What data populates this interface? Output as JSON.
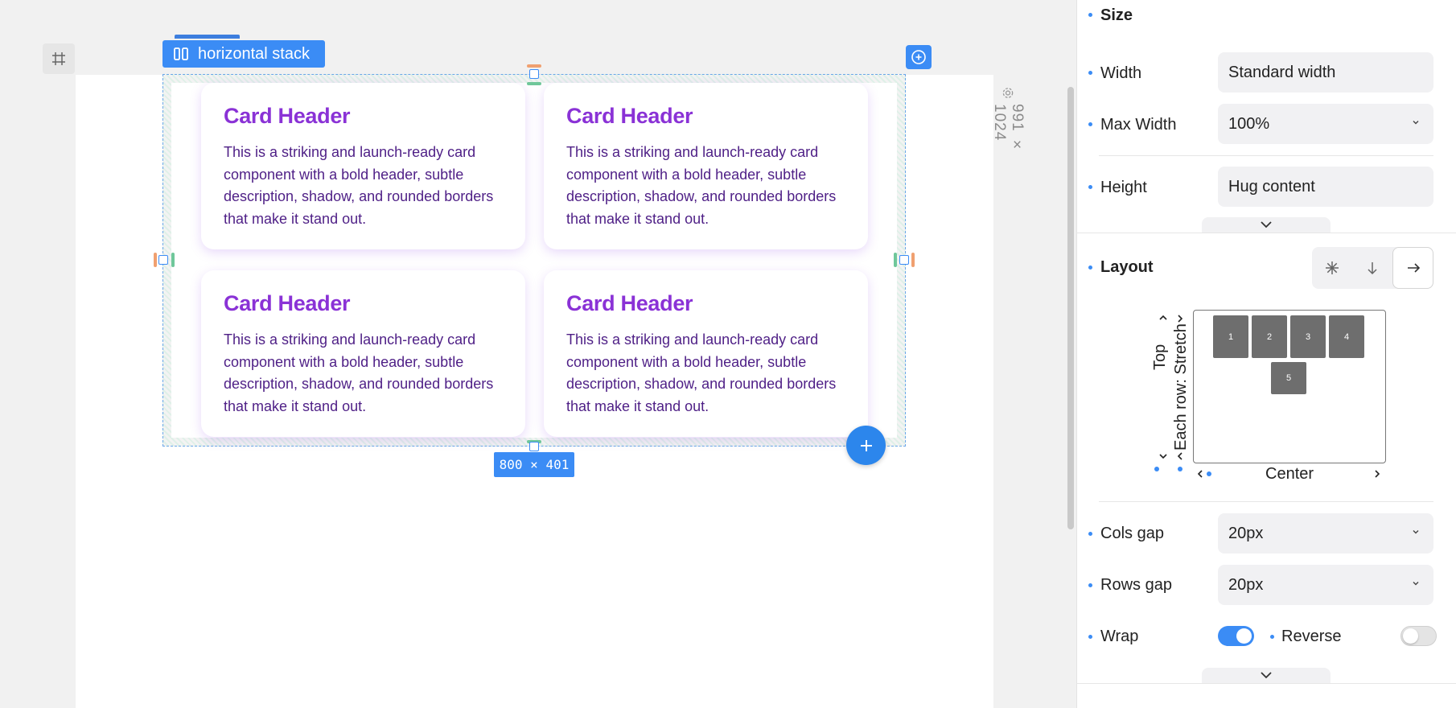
{
  "canvas": {
    "stack_tag_label": "horizontal stack",
    "page_dimensions": "991 × 1024",
    "selection_size": "800 × 401",
    "cards": [
      {
        "header": "Card Header",
        "body": "This is a striking and launch-ready card component with a bold header, subtle description, shadow, and rounded borders that make it stand out."
      },
      {
        "header": "Card Header",
        "body": "This is a striking and launch-ready card component with a bold header, subtle description, shadow, and rounded borders that make it stand out."
      },
      {
        "header": "Card Header",
        "body": "This is a striking and launch-ready card component with a bold header, subtle description, shadow, and rounded borders that make it stand out."
      },
      {
        "header": "Card Header",
        "body": "This is a striking and launch-ready card component with a bold header, subtle description, shadow, and rounded borders that make it stand out."
      }
    ]
  },
  "panel": {
    "size": {
      "title": "Size",
      "width_label": "Width",
      "width_value": "Standard width",
      "max_width_label": "Max Width",
      "max_width_value": "100%",
      "height_label": "Height",
      "height_value": "Hug content"
    },
    "layout": {
      "title": "Layout",
      "direction_options": [
        "grid",
        "vertical",
        "horizontal"
      ],
      "direction_selected": "horizontal",
      "vertical_align": "Top",
      "row_align": "Each row: Stretch",
      "horizontal_align": "Center",
      "preview_cells": [
        "1",
        "2",
        "3",
        "4",
        "5"
      ],
      "cols_gap_label": "Cols gap",
      "cols_gap_value": "20px",
      "rows_gap_label": "Rows gap",
      "rows_gap_value": "20px",
      "wrap_label": "Wrap",
      "wrap_on": true,
      "reverse_label": "Reverse",
      "reverse_on": false
    }
  },
  "colors": {
    "accent": "#3b8cf5",
    "card_header": "#8a32d6",
    "card_text": "#4e1f86"
  }
}
